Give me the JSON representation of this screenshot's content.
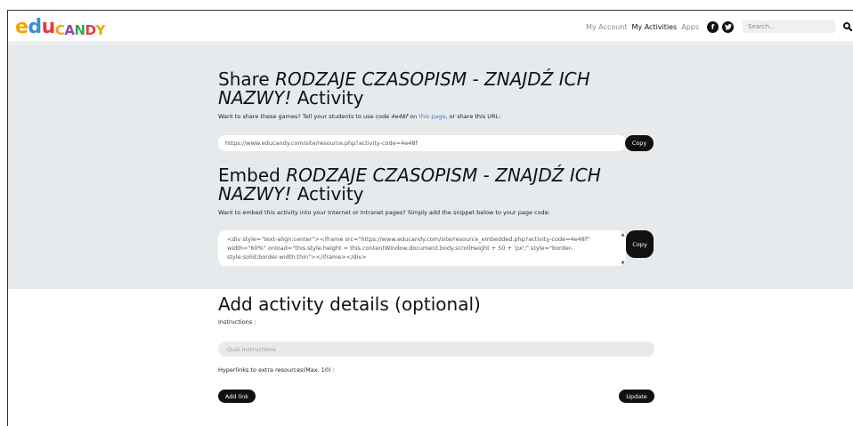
{
  "logo": {
    "text": "educandy",
    "colors": [
      "#f4a300",
      "#3a8fd8",
      "#e83a3a",
      "#f4a300",
      "#9c3fb8",
      "#3aa35a",
      "#e83a3a",
      "#f4a300"
    ]
  },
  "nav": {
    "links": [
      {
        "label": "My Account",
        "active": false
      },
      {
        "label": "My Activities",
        "active": true
      },
      {
        "label": "Apps",
        "active": false
      }
    ],
    "social": [
      {
        "icon": "facebook-icon",
        "glyph": "f"
      },
      {
        "icon": "twitter-icon",
        "glyph": "t"
      }
    ],
    "search_placeholder": "Search...",
    "search_icon": "search-icon"
  },
  "share": {
    "title_prefix": "Share",
    "title_italic": "RODZAJE CZASOPISM - ZNAJDŹ ICH NAZWY!",
    "title_suffix": "Activity",
    "desc_before": "Want to share these games? Tell your students to use code",
    "code": "4e48f",
    "desc_middle": "on",
    "link_text": "this page",
    "desc_after": ", or share this URL:",
    "url": "https://www.educandy.com/site/resource.php?activity-code=4e48f",
    "copy_label": "Copy"
  },
  "embed": {
    "title_prefix": "Embed",
    "title_italic": "RODZAJE CZASOPISM - ZNAJDŹ ICH NAZWY!",
    "title_suffix": "Activity",
    "desc": "Want to embed this activity into your Internet or Intranet pages? Simply add the snippet below to your page code:",
    "snippet": "<div style=\"text-align:center\"><iframe src=\"https://www.educandy.com/site/resource_embedded.php?activity-code=4e48f\" width=\"60%\" onload=\"this.style.height = this.contentWindow.document.body.scrollHeight + 50 + 'px';\" style=\"border-style:solid;border-width:thin\"></iframe></div>",
    "copy_label": "Copy"
  },
  "details": {
    "title": "Add activity details (optional)",
    "instructions_label": "Instructions :",
    "instructions_placeholder": "Quiz Instructions",
    "hyperlinks_label": "Hyperlinks to extra resources(Max. 10) :",
    "add_link_label": "Add link",
    "update_label": "Update"
  }
}
